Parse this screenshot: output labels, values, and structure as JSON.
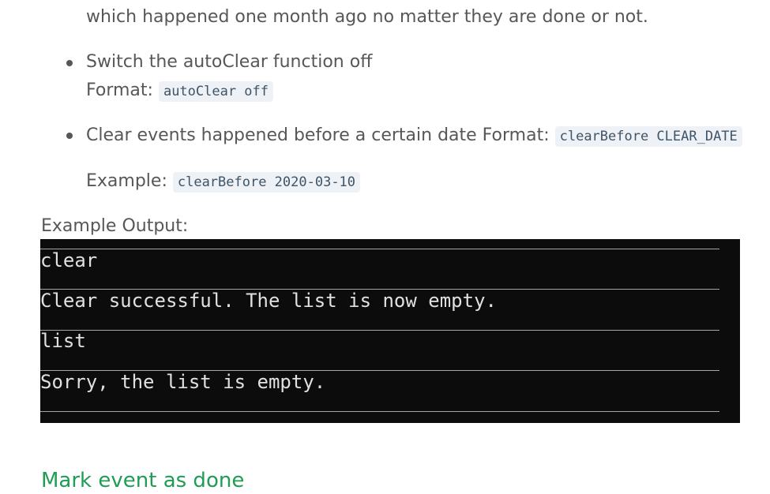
{
  "intro_tail": "which happened one month ago no matter they are done or not.",
  "bullets": [
    {
      "text": "Switch the autoClear function off",
      "format_label": "Format:",
      "format_code": "autoClear off"
    },
    {
      "text": "Clear events happened before a certain date Format:",
      "format_code": "clearBefore CLEAR_DATE",
      "example_label": "Example:",
      "example_code": "clearBefore 2020-03-10"
    }
  ],
  "example_output_label": "Example Output:",
  "console_lines": [
    "clear",
    "Clear successful. The list is now empty.",
    "list",
    "Sorry, the list is empty."
  ],
  "next_section_heading": "Mark event as done",
  "colors": {
    "heading_green": "#1f9d55",
    "console_bg": "#0c0c0c",
    "code_bg": "#eef1f5"
  }
}
